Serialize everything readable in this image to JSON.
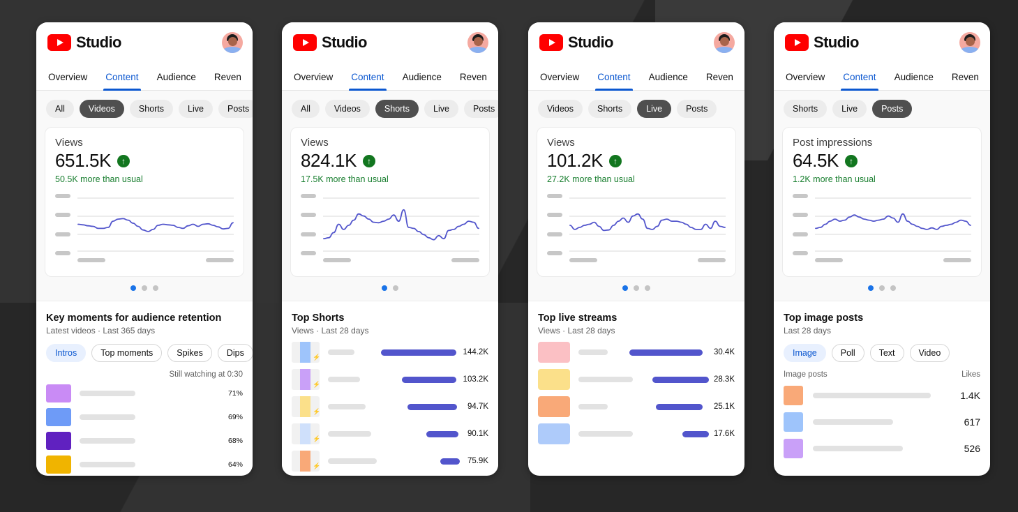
{
  "header": {
    "brand_name": "Studio",
    "logo_icon": "youtube-play-icon",
    "avatar_icon": "user-avatar-icon"
  },
  "tabs": [
    {
      "label": "Overview",
      "active": false
    },
    {
      "label": "Content",
      "active": true
    },
    {
      "label": "Audience",
      "active": false
    },
    {
      "label": "Reven",
      "active": false
    }
  ],
  "panels": [
    {
      "id": "videos",
      "chips": [
        {
          "label": "All",
          "selected": false
        },
        {
          "label": "Videos",
          "selected": true
        },
        {
          "label": "Shorts",
          "selected": false
        },
        {
          "label": "Live",
          "selected": false
        },
        {
          "label": "Posts",
          "selected": false
        }
      ],
      "metric": {
        "title": "Views",
        "value": "651.5K",
        "trend_icon": "arrow-up-icon",
        "subtitle": "50.5K more than usual"
      },
      "dots": {
        "count": 3,
        "active": 0
      },
      "section": {
        "title": "Key moments for audience retention",
        "subtitle": "Latest videos · Last 365 days",
        "subchips": [
          {
            "label": "Intros",
            "selected": true
          },
          {
            "label": "Top moments",
            "selected": false
          },
          {
            "label": "Spikes",
            "selected": false
          },
          {
            "label": "Dips",
            "selected": false
          }
        ],
        "column_header_right": "Still watching at 0:30",
        "rows": [
          {
            "thumb_color": "#c98bf5",
            "value": "71%"
          },
          {
            "thumb_color": "#6e9bf7",
            "value": "69%"
          },
          {
            "thumb_color": "#6021c0",
            "value": "68%"
          },
          {
            "thumb_color": "#f0b400",
            "value": "64%"
          }
        ]
      }
    },
    {
      "id": "shorts",
      "chips": [
        {
          "label": "All",
          "selected": false
        },
        {
          "label": "Videos",
          "selected": false
        },
        {
          "label": "Shorts",
          "selected": true
        },
        {
          "label": "Live",
          "selected": false
        },
        {
          "label": "Posts",
          "selected": false
        }
      ],
      "metric": {
        "title": "Views",
        "value": "824.1K",
        "trend_icon": "arrow-up-icon",
        "subtitle": "17.5K more than usual"
      },
      "dots": {
        "count": 2,
        "active": 0
      },
      "section": {
        "title": "Top Shorts",
        "subtitle": "Views · Last 28 days",
        "rows": [
          {
            "thumb_color": "#9ec4fb",
            "value": "144.2K",
            "bar_pct": 100
          },
          {
            "thumb_color": "#c9a0f8",
            "value": "103.2K",
            "bar_pct": 72
          },
          {
            "thumb_color": "#fbe08a",
            "value": "94.7K",
            "bar_pct": 66
          },
          {
            "thumb_color": "#cfe0fb",
            "value": "90.1K",
            "bar_pct": 43
          },
          {
            "thumb_color": "#f9a978",
            "value": "75.9K",
            "bar_pct": 26
          }
        ]
      }
    },
    {
      "id": "live",
      "chips": [
        {
          "label": "Videos",
          "selected": false
        },
        {
          "label": "Shorts",
          "selected": false
        },
        {
          "label": "Live",
          "selected": true
        },
        {
          "label": "Posts",
          "selected": false
        }
      ],
      "metric": {
        "title": "Views",
        "value": "101.2K",
        "trend_icon": "arrow-up-icon",
        "subtitle": "27.2K more than usual"
      },
      "dots": {
        "count": 3,
        "active": 0
      },
      "section": {
        "title": "Top live streams",
        "subtitle": "Views · Last 28 days",
        "rows": [
          {
            "thumb_color": "#fbc0c4",
            "value": "30.4K",
            "bar_pct": 100
          },
          {
            "thumb_color": "#fbe08a",
            "value": "28.3K",
            "bar_pct": 77
          },
          {
            "thumb_color": "#f9a978",
            "value": "25.1K",
            "bar_pct": 64
          },
          {
            "thumb_color": "#aecbfa",
            "value": "17.6K",
            "bar_pct": 36
          }
        ]
      }
    },
    {
      "id": "posts",
      "chips": [
        {
          "label": "Shorts",
          "selected": false
        },
        {
          "label": "Live",
          "selected": false
        },
        {
          "label": "Posts",
          "selected": true
        }
      ],
      "metric": {
        "title": "Post impressions",
        "value": "64.5K",
        "trend_icon": "arrow-up-icon",
        "subtitle": "1.2K more than usual"
      },
      "dots": {
        "count": 3,
        "active": 0
      },
      "section": {
        "title": "Top image posts",
        "subtitle": "Last 28 days",
        "subchips": [
          {
            "label": "Image",
            "selected": true
          },
          {
            "label": "Poll",
            "selected": false
          },
          {
            "label": "Text",
            "selected": false
          },
          {
            "label": "Video",
            "selected": false
          }
        ],
        "column_header_left": "Image posts",
        "column_header_right": "Likes",
        "rows": [
          {
            "thumb_color": "#f9a978",
            "value": "1.4K",
            "title_pct": 88
          },
          {
            "thumb_color": "#9ec4fb",
            "value": "617",
            "title_pct": 60
          },
          {
            "thumb_color": "#c9a0f8",
            "value": "526",
            "title_pct": 67
          }
        ]
      }
    }
  ],
  "chart_data": [
    {
      "type": "line",
      "title": "Views",
      "panel": "videos",
      "ylabel": "",
      "xlabel": "",
      "y": [
        52,
        51,
        49,
        48,
        44,
        44,
        46,
        58,
        62,
        63,
        60,
        54,
        48,
        41,
        38,
        42,
        50,
        52,
        51,
        50,
        46,
        44,
        49,
        52,
        48,
        52,
        53,
        50,
        47,
        43,
        44,
        55
      ],
      "ylim": [
        0,
        100
      ],
      "grid": true
    },
    {
      "type": "line",
      "title": "Views",
      "panel": "shorts",
      "ylabel": "",
      "xlabel": "",
      "y": [
        24,
        26,
        36,
        52,
        42,
        50,
        60,
        72,
        68,
        62,
        56,
        55,
        58,
        62,
        70,
        58,
        80,
        46,
        44,
        38,
        32,
        26,
        22,
        30,
        24,
        40,
        42,
        48,
        52,
        58,
        56,
        44
      ],
      "ylim": [
        0,
        100
      ],
      "grid": true
    },
    {
      "type": "line",
      "title": "Views",
      "panel": "live",
      "ylabel": "",
      "xlabel": "",
      "y": [
        50,
        42,
        46,
        50,
        52,
        56,
        48,
        40,
        41,
        50,
        58,
        64,
        56,
        68,
        72,
        62,
        44,
        42,
        48,
        60,
        62,
        58,
        58,
        56,
        52,
        46,
        42,
        42,
        52,
        44,
        58,
        48,
        46
      ],
      "ylim": [
        0,
        100
      ],
      "grid": true
    },
    {
      "type": "line",
      "title": "Post impressions",
      "panel": "posts",
      "ylabel": "",
      "xlabel": "",
      "y": [
        44,
        46,
        52,
        58,
        62,
        58,
        60,
        66,
        70,
        66,
        62,
        60,
        58,
        60,
        62,
        68,
        64,
        56,
        72,
        58,
        52,
        48,
        44,
        42,
        45,
        42,
        48,
        50,
        52,
        56,
        60,
        58,
        50
      ],
      "ylim": [
        0,
        100
      ],
      "grid": true
    }
  ],
  "colors": {
    "brand_red": "#ff0000",
    "accent_blue": "#0b57d0",
    "positive_green": "#1a7f30",
    "line_indigo": "#5255cc",
    "chip_selected_bg": "#4f4f4f"
  }
}
